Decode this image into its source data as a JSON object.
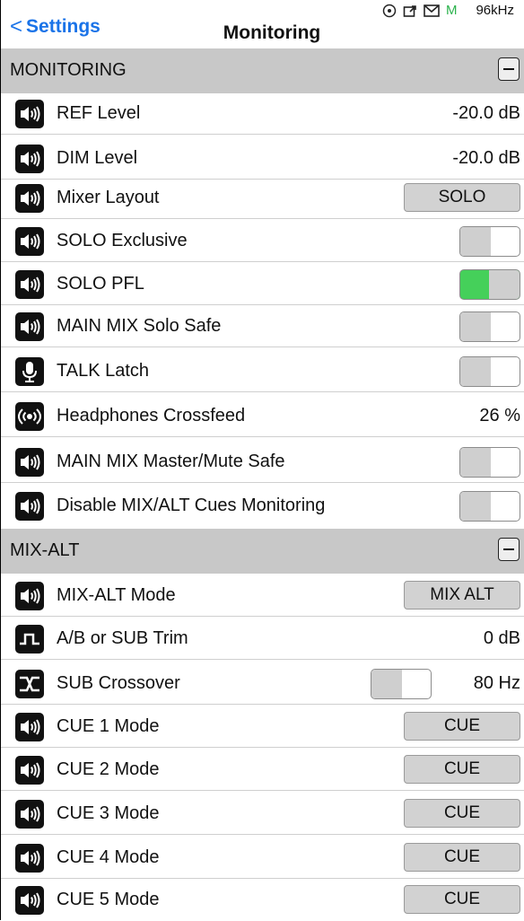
{
  "nav": {
    "back_label": "Settings",
    "title": "Monitoring"
  },
  "status": {
    "mode_letter": "M",
    "sample_rate": "96kHz"
  },
  "sections": {
    "monitoring": {
      "label": "MONITORING"
    },
    "mix_alt": {
      "label": "MIX-ALT"
    }
  },
  "rows": {
    "ref_level": {
      "label": "REF Level",
      "value": "-20.0 dB"
    },
    "dim_level": {
      "label": "DIM Level",
      "value": "-20.0 dB"
    },
    "mixer_layout": {
      "label": "Mixer Layout",
      "button": "SOLO"
    },
    "solo_exclusive": {
      "label": "SOLO Exclusive",
      "state": "off"
    },
    "solo_pfl": {
      "label": "SOLO PFL",
      "state": "on"
    },
    "main_mix_solo_safe": {
      "label": "MAIN MIX Solo Safe",
      "state": "off"
    },
    "talk_latch": {
      "label": "TALK Latch",
      "state": "off"
    },
    "headphones_crossfeed": {
      "label": "Headphones Crossfeed",
      "value": "26 %"
    },
    "main_mix_master_mute_safe": {
      "label": "MAIN MIX Master/Mute Safe",
      "state": "off"
    },
    "disable_mix_alt_cues": {
      "label": "Disable MIX/ALT Cues Monitoring",
      "state": "off"
    },
    "mix_alt_mode": {
      "label": "MIX-ALT Mode",
      "button": "MIX ALT"
    },
    "ab_sub_trim": {
      "label": "A/B or SUB Trim",
      "value": "0 dB"
    },
    "sub_crossover": {
      "label": "SUB Crossover",
      "value": "80 Hz",
      "state": "off"
    },
    "cue1": {
      "label": "CUE 1 Mode",
      "button": "CUE"
    },
    "cue2": {
      "label": "CUE 2 Mode",
      "button": "CUE"
    },
    "cue3": {
      "label": "CUE 3 Mode",
      "button": "CUE"
    },
    "cue4": {
      "label": "CUE 4 Mode",
      "button": "CUE"
    },
    "cue5": {
      "label": "CUE 5 Mode",
      "button": "CUE"
    }
  },
  "icons": {
    "speaker": "speaker-icon",
    "microphone": "microphone-icon",
    "headphones": "headphones-broadcast-icon",
    "square_wave": "square-wave-icon",
    "crossover": "crossover-icon",
    "status_knob": "knob-icon",
    "status_export": "export-icon",
    "status_mail": "mail-icon"
  },
  "colors": {
    "accent": "#1a73e8",
    "toggle_on": "#45d05a",
    "section_bg": "#c8c8c8"
  }
}
